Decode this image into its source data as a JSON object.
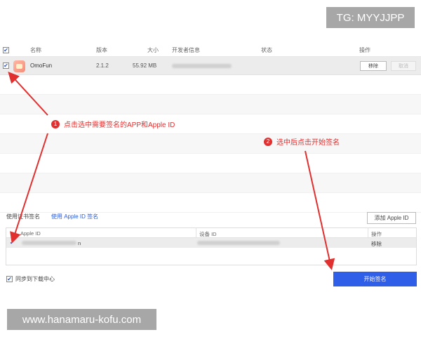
{
  "watermarks": {
    "top": "TG: MYYJJPP",
    "bottom": "www.hanamaru-kofu.com"
  },
  "app_table": {
    "headers": [
      "名称",
      "版本",
      "大小",
      "开发者信息",
      "状态",
      "操作"
    ],
    "row": {
      "checked": true,
      "name": "OmoFun",
      "version": "2.1.2",
      "size": "55.92 MB",
      "remove_label": "移除",
      "cancel_label": "取消"
    }
  },
  "annotations": {
    "step1": {
      "num": "1",
      "text": "点击选中需要签名的APP和Apple ID"
    },
    "step2": {
      "num": "2",
      "text": "选中后点击开始签名"
    }
  },
  "signing": {
    "tab_cert": "使用证书签名",
    "tab_appleid": "使用 Apple ID 签名",
    "add_button": "添加 Apple ID",
    "id_table": {
      "headers": [
        "Apple ID",
        "设备 ID",
        "操作"
      ],
      "row": {
        "checked": true,
        "apple_id_suffix": "n",
        "action": "移除"
      }
    }
  },
  "footer": {
    "sync_label": "同步到下载中心",
    "sync_checked": true,
    "start_button": "开始签名"
  },
  "colors": {
    "accent": "#2f5ee8",
    "annotation": "#e03030"
  }
}
